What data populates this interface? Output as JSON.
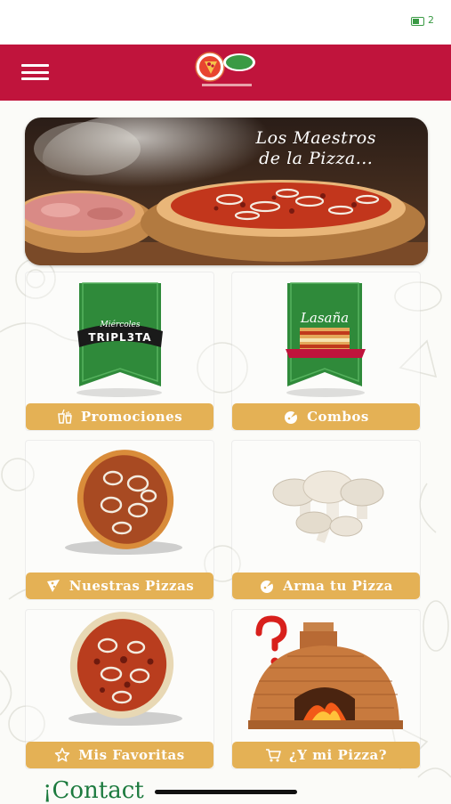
{
  "status_bar": {
    "battery_text": "2"
  },
  "header": {
    "menu_icon": "hamburger-icon",
    "brand_color": "#c0143c"
  },
  "banner": {
    "title_line1": "Los Maestros",
    "title_line2": "de la Pizza..."
  },
  "cards": [
    {
      "label": "Promociones",
      "icon": "drink-fries-icon",
      "image": "miercoles-tripleta-banner"
    },
    {
      "label": "Combos",
      "icon": "pizza-coin-icon",
      "image": "lasagna-banner",
      "image_text": "Lasaña"
    },
    {
      "label": "Nuestras Pizzas",
      "icon": "pizza-slice-icon",
      "image": "onion-pizza"
    },
    {
      "label": "Arma tu Pizza",
      "icon": "pizza-coin-icon",
      "image": "mushrooms"
    },
    {
      "label": "Mis Favoritas",
      "icon": "star-icon",
      "image": "pepperoni-pizza"
    },
    {
      "label": "¿Y mi Pizza?",
      "icon": "cart-icon",
      "image": "brick-oven"
    }
  ],
  "tripleta_banner": {
    "line1": "Miércoles",
    "line2": "TRIPL3TA"
  },
  "bottom_text": "¡Contact",
  "colors": {
    "button": "#e4b155",
    "ribbon_green": "#2f8a3a",
    "bottom_text": "#1c7a3e"
  }
}
